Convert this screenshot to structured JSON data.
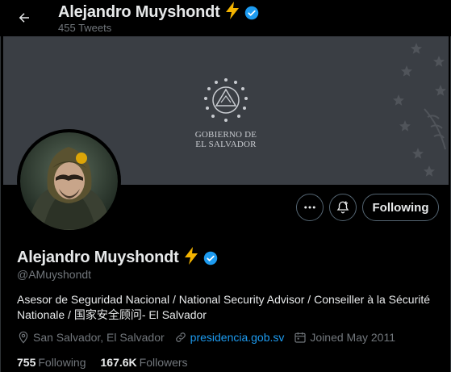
{
  "header": {
    "name": "Alejandro Muyshondt",
    "emoji": "⚡",
    "tweet_count": "455 Tweets"
  },
  "banner": {
    "line1": "GOBIERNO DE",
    "line2": "EL SALVADOR"
  },
  "actions": {
    "follow_label": "Following"
  },
  "profile": {
    "name": "Alejandro Muyshondt",
    "emoji": "⚡",
    "handle": "@AMuyshondt",
    "bio": "Asesor de Seguridad Nacional / National Security Advisor / Conseiller à la Sécurité Nationale / 国家安全顾问- El Salvador",
    "location": "San Salvador, El Salvador",
    "website": "presidencia.gob.sv",
    "joined": "Joined May 2011"
  },
  "stats": {
    "following_count": "755",
    "following_label": "Following",
    "followers_count": "167.6K",
    "followers_label": "Followers"
  },
  "colors": {
    "accent": "#1d9bf0",
    "verified": "#1d9bf0",
    "lightning": "#f4b400",
    "muted": "#71767b",
    "banner": "#3a3e44"
  }
}
